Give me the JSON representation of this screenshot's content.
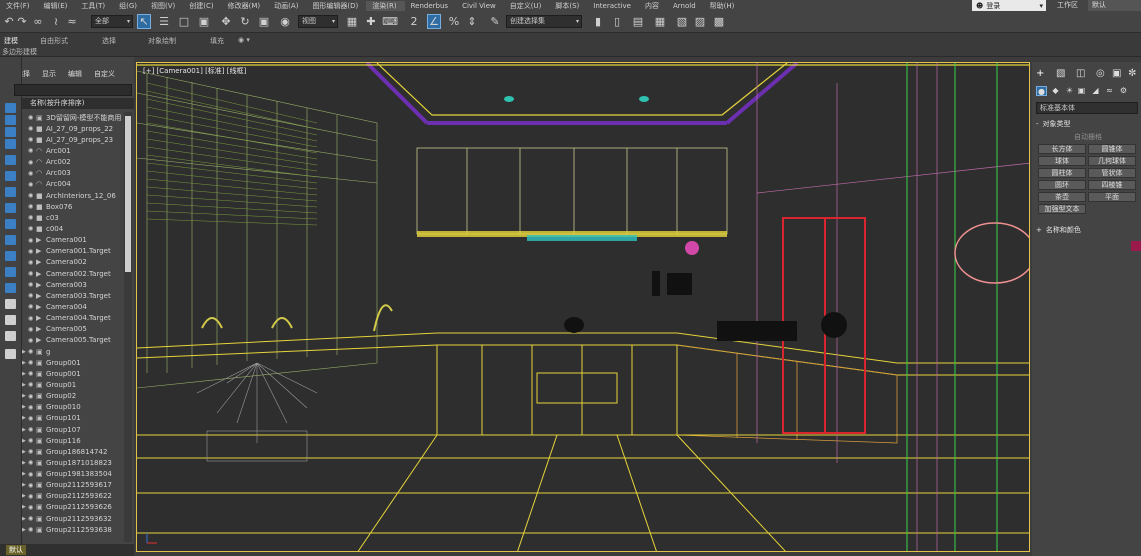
{
  "menubar": {
    "items": [
      "文件(F)",
      "编辑(E)",
      "工具(T)",
      "组(G)",
      "视图(V)",
      "创建(C)",
      "修改器(M)",
      "动画(A)",
      "图形编辑器(D)",
      "渲染(R)",
      "Renderbus",
      "Civil View",
      "自定义(U)",
      "脚本(S)",
      "Interactive",
      "内容",
      "Arnold",
      "帮助(H)"
    ],
    "highlighted_label": "渲染(R)",
    "login": {
      "icon": "user-icon",
      "label": "登录"
    },
    "workspace_label": "工作区",
    "workspace_value": "默认"
  },
  "toolbar": {
    "selection_filter": "全部",
    "reference_coord": "视图",
    "named_selection": "创建选择集"
  },
  "ribbon": {
    "tabs": [
      "建模",
      "自由形式",
      "选择",
      "对象绘制",
      "填充"
    ],
    "active_tab": "建模",
    "sublabel": "多边形建模"
  },
  "scene_explorer": {
    "tabs": [
      "选择",
      "显示",
      "编辑",
      "自定义"
    ],
    "column_header": "名称(按升序排序)",
    "items": [
      {
        "name": "3D留留网-模型不能商用",
        "type": "group",
        "expandable": false
      },
      {
        "name": "AI_27_09_props_22",
        "type": "mesh",
        "expandable": false
      },
      {
        "name": "AI_27_09_props_23",
        "type": "mesh",
        "expandable": false
      },
      {
        "name": "Arc001",
        "type": "shape",
        "expandable": false
      },
      {
        "name": "Arc002",
        "type": "shape",
        "expandable": false
      },
      {
        "name": "Arc003",
        "type": "shape",
        "expandable": false
      },
      {
        "name": "Arc004",
        "type": "shape",
        "expandable": false
      },
      {
        "name": "ArchInteriors_12_06",
        "type": "mesh",
        "expandable": false
      },
      {
        "name": "Box076",
        "type": "mesh",
        "expandable": false
      },
      {
        "name": "c03",
        "type": "mesh",
        "expandable": false
      },
      {
        "name": "c004",
        "type": "mesh",
        "expandable": false
      },
      {
        "name": "Camera001",
        "type": "camera",
        "expandable": false
      },
      {
        "name": "Camera001.Target",
        "type": "camera",
        "expandable": false
      },
      {
        "name": "Camera002",
        "type": "camera",
        "expandable": false
      },
      {
        "name": "Camera002.Target",
        "type": "camera",
        "expandable": false
      },
      {
        "name": "Camera003",
        "type": "camera",
        "expandable": false
      },
      {
        "name": "Camera003.Target",
        "type": "camera",
        "expandable": false
      },
      {
        "name": "Camera004",
        "type": "camera",
        "expandable": false
      },
      {
        "name": "Camera004.Target",
        "type": "camera",
        "expandable": false
      },
      {
        "name": "Camera005",
        "type": "camera",
        "expandable": false
      },
      {
        "name": "Camera005.Target",
        "type": "camera",
        "expandable": false
      },
      {
        "name": "g",
        "type": "group",
        "expandable": true
      },
      {
        "name": "Group001",
        "type": "group",
        "expandable": true
      },
      {
        "name": "Group001",
        "type": "group",
        "expandable": true
      },
      {
        "name": "Group01",
        "type": "group",
        "expandable": true
      },
      {
        "name": "Group02",
        "type": "group",
        "expandable": true
      },
      {
        "name": "Group010",
        "type": "group",
        "expandable": true
      },
      {
        "name": "Group101",
        "type": "group",
        "expandable": true
      },
      {
        "name": "Group107",
        "type": "group",
        "expandable": true
      },
      {
        "name": "Group116",
        "type": "group",
        "expandable": true
      },
      {
        "name": "Group186814742",
        "type": "group",
        "expandable": true
      },
      {
        "name": "Group1871018823",
        "type": "group",
        "expandable": true
      },
      {
        "name": "Group1981383504",
        "type": "group",
        "expandable": true
      },
      {
        "name": "Group2112593617",
        "type": "group",
        "expandable": true
      },
      {
        "name": "Group2112593622",
        "type": "group",
        "expandable": true
      },
      {
        "name": "Group2112593626",
        "type": "group",
        "expandable": true
      },
      {
        "name": "Group2112593632",
        "type": "group",
        "expandable": true
      },
      {
        "name": "Group2112593638",
        "type": "group",
        "expandable": true
      }
    ]
  },
  "statusbar": {
    "tag": "默认"
  },
  "viewport": {
    "label": "[+] [Camera001] [标准] [线框]",
    "border_color": "#e2c34a"
  },
  "command_panel": {
    "category_dropdown": "标准基本体",
    "rollout_object_type": "对象类型",
    "autogrid_label": "自动栅格",
    "object_buttons": [
      "长方体",
      "圆锥体",
      "球体",
      "几何球体",
      "圆柱体",
      "管状体",
      "圆环",
      "四棱锥",
      "茶壶",
      "平面",
      "加强型文本"
    ],
    "rollout_name_color": "名称和颜色",
    "object_color": "#9a1a4c"
  }
}
